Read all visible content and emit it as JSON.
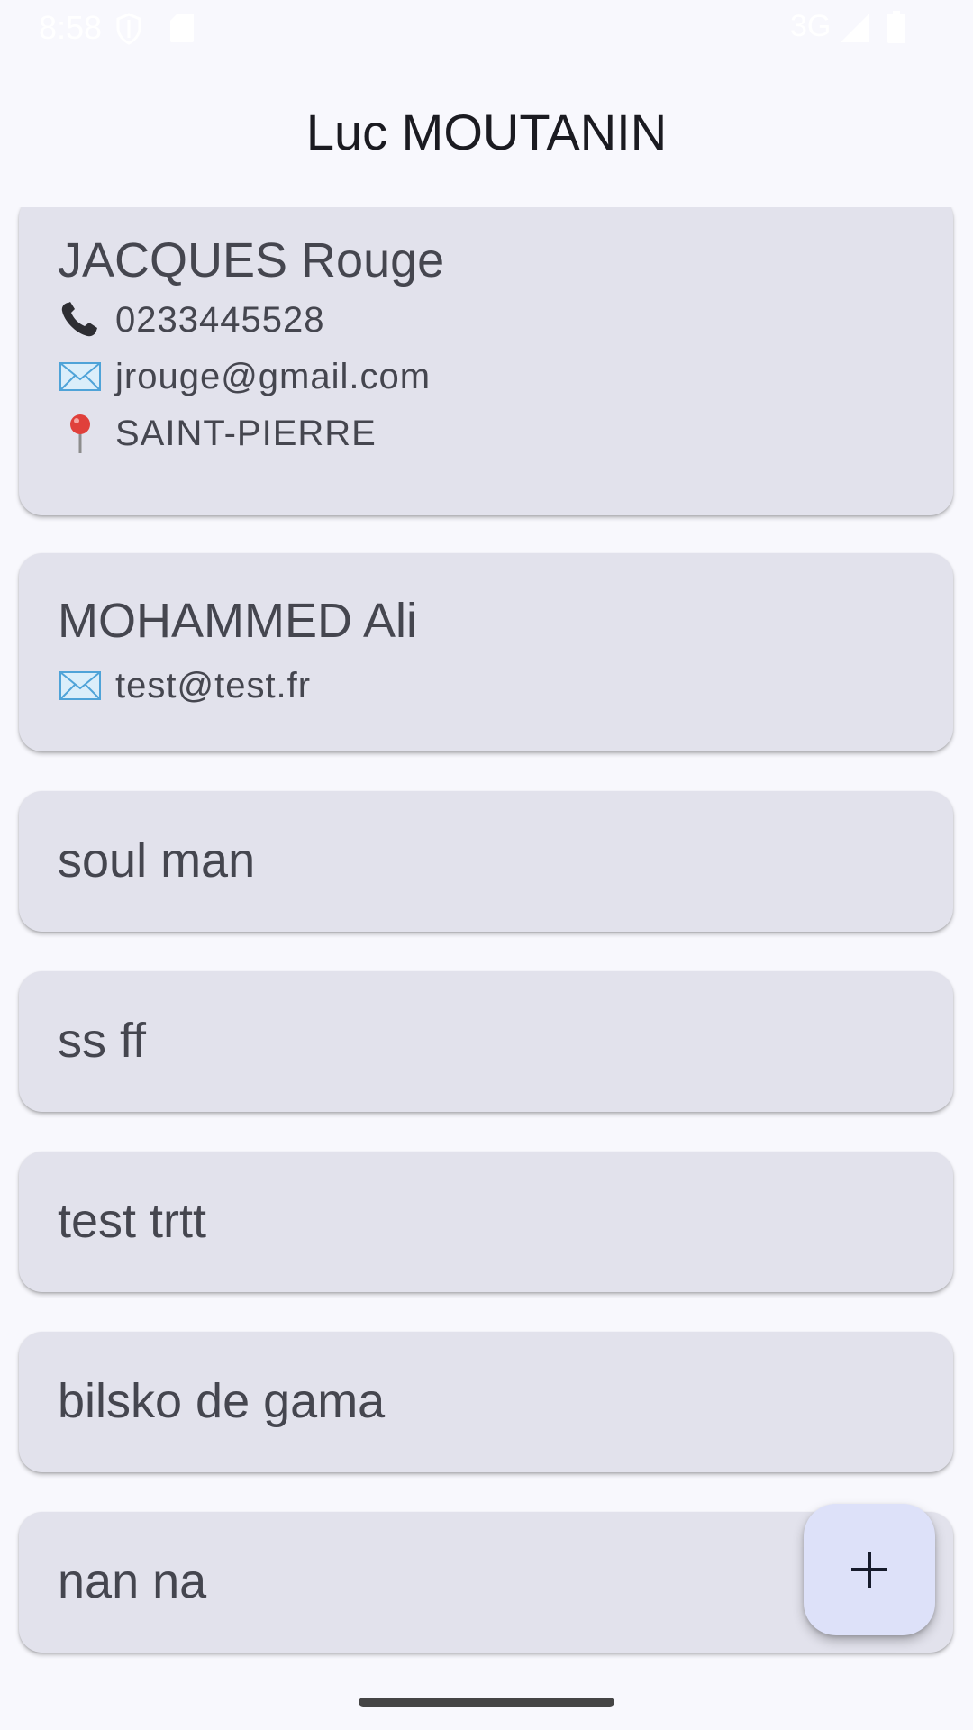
{
  "status_bar": {
    "time": "8:58",
    "network": "3G",
    "icons": [
      "shield-icon",
      "sd-card-icon",
      "signal-icon",
      "battery-icon"
    ]
  },
  "header": {
    "title": "Luc MOUTANIN"
  },
  "contacts": [
    {
      "name": "JACQUES Rouge",
      "phone": "0233445528",
      "email": "jrouge@gmail.com",
      "city": "SAINT-PIERRE"
    },
    {
      "name": "MOHAMMED Ali",
      "email": "test@test.fr"
    },
    {
      "name": "soul man"
    },
    {
      "name": "ss ff"
    },
    {
      "name": "test trtt"
    },
    {
      "name": "bilsko de gama"
    },
    {
      "name": "nan na"
    }
  ],
  "fab": {
    "icon": "plus-icon"
  },
  "colors": {
    "background": "#f8f8fd",
    "card": "#e2e2ec",
    "text": "#45464f",
    "title": "#1b1b21",
    "fab": "#dde1f9",
    "fab_icon": "#161b2c"
  }
}
